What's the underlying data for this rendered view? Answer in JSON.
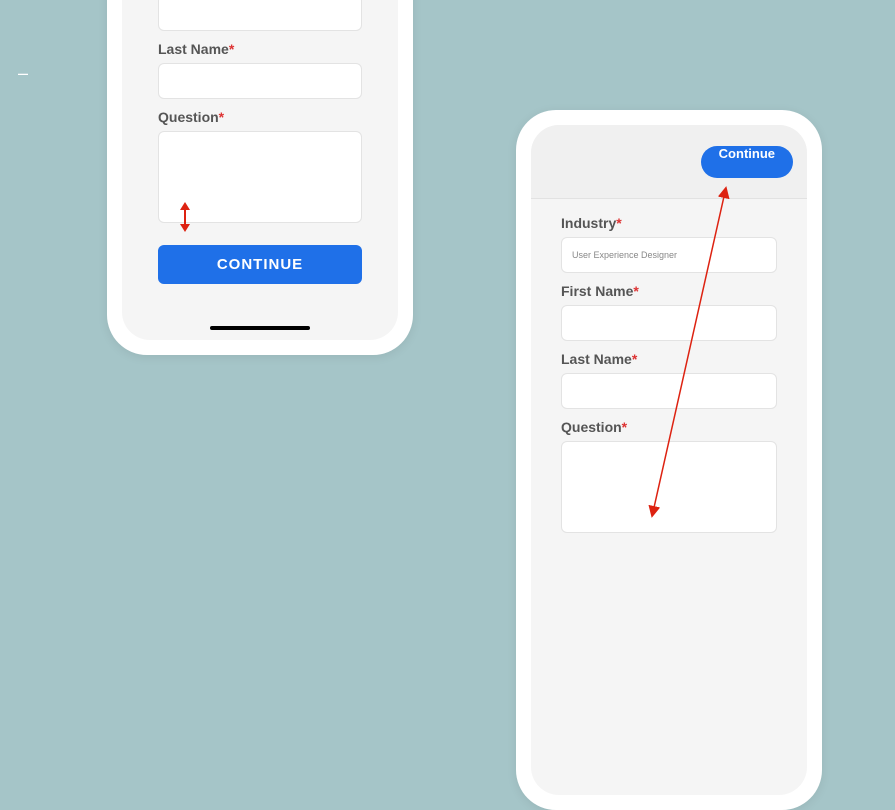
{
  "decor": {
    "dash": "–"
  },
  "phone1": {
    "last_name_label": "Last Name",
    "question_label": "Question",
    "continue_label": "CONTINUE",
    "required": "*"
  },
  "phone2": {
    "continue_label": "Continue",
    "industry_label": "Industry",
    "industry_value": "User Experience Designer",
    "first_name_label": "First Name",
    "last_name_label": "Last Name",
    "question_label": "Question",
    "required": "*"
  }
}
